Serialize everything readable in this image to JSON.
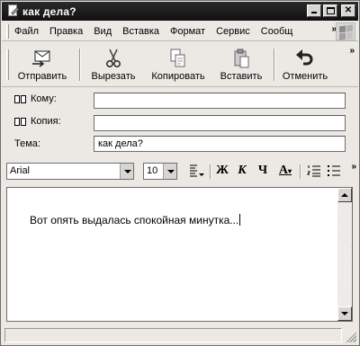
{
  "window": {
    "title": "как дела?"
  },
  "menu": {
    "items": [
      {
        "label": "Файл"
      },
      {
        "label": "Правка"
      },
      {
        "label": "Вид"
      },
      {
        "label": "Вставка"
      },
      {
        "label": "Формат"
      },
      {
        "label": "Сервис"
      },
      {
        "label": "Сообщ"
      }
    ]
  },
  "toolbar": {
    "send_label": "Отправить",
    "cut_label": "Вырезать",
    "copy_label": "Копировать",
    "paste_label": "Вставить",
    "undo_label": "Отменить"
  },
  "header": {
    "to_label": "Кому:",
    "to_value": "",
    "cc_label": "Копия:",
    "cc_value": "",
    "subject_label": "Тема:",
    "subject_value": "как дела?"
  },
  "format": {
    "font_name": "Arial",
    "font_size": "10",
    "bold_label": "Ж",
    "italic_label": "К",
    "underline_label": "Ч",
    "font_color_label": "А"
  },
  "message": {
    "body": "Вот опять выдалась спокойная минутка..."
  },
  "icons": {
    "send": "send-icon",
    "cut": "scissors-icon",
    "copy": "copy-icon",
    "paste": "paste-icon",
    "undo": "undo-icon"
  }
}
